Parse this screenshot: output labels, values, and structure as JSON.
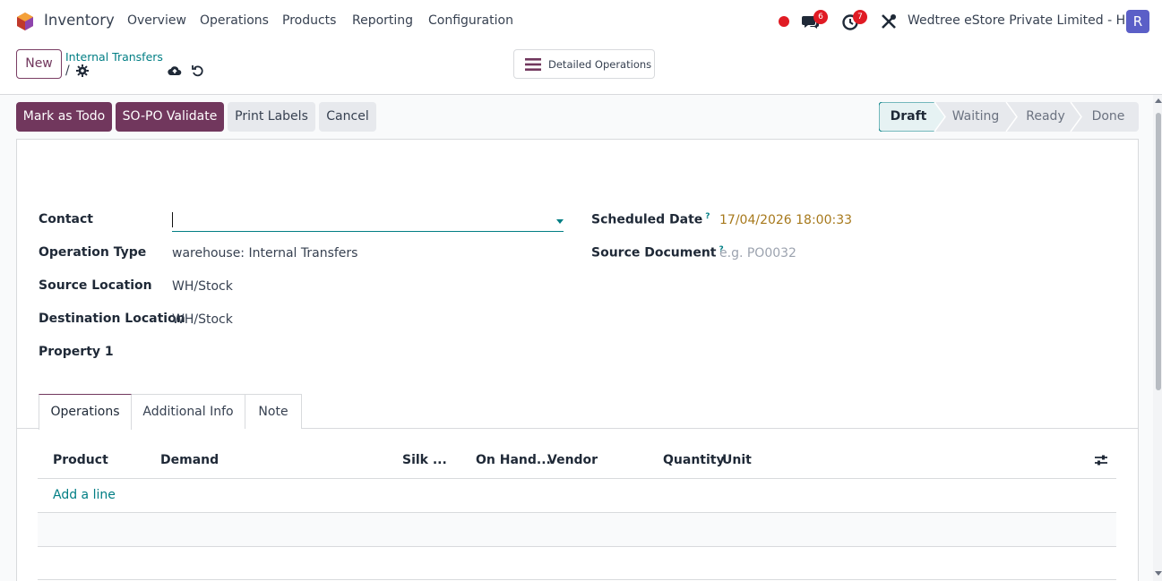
{
  "navbar": {
    "app_name": "Inventory",
    "menu": [
      "Overview",
      "Operations",
      "Products",
      "Reporting",
      "Configuration"
    ],
    "messages_count": "6",
    "activities_count": "7",
    "company": "Wedtree eStore Private Limited - HO",
    "avatar_letter": "R",
    "icons": [
      "inventory-logo-icon",
      "status-dot-icon",
      "chat-icon",
      "clock-icon",
      "tools-icon"
    ]
  },
  "control_panel": {
    "new_label": "New",
    "breadcrumb": "Internal Transfers",
    "breadcrumb_sep": "/",
    "detailed_operations_label": "Detailed Operations"
  },
  "actions": {
    "mark_todo": "Mark as Todo",
    "so_po_validate": "SO-PO Validate",
    "print_labels": "Print Labels",
    "cancel": "Cancel"
  },
  "status_stages": [
    {
      "label": "Draft",
      "active": true
    },
    {
      "label": "Waiting",
      "active": false
    },
    {
      "label": "Ready",
      "active": false
    },
    {
      "label": "Done",
      "active": false
    }
  ],
  "form": {
    "contact_label": "Contact",
    "contact_value": "",
    "operation_type_label": "Operation Type",
    "operation_type_value": "warehouse: Internal Transfers",
    "source_location_label": "Source Location",
    "source_location_value": "WH/Stock",
    "destination_location_label": "Destination Location",
    "destination_location_value": "WH/Stock",
    "property_label": "Property 1",
    "scheduled_date_label": "Scheduled Date",
    "scheduled_date_value": "17/04/2026 18:00:33",
    "source_document_label": "Source Document",
    "source_document_placeholder": "e.g. PO0032",
    "help_mark": "?"
  },
  "tabs": [
    {
      "label": "Operations",
      "active": true
    },
    {
      "label": "Additional Info",
      "active": false
    },
    {
      "label": "Note",
      "active": false
    }
  ],
  "table": {
    "columns": [
      "Product",
      "Demand",
      "Silk ...",
      "On Hand...",
      "Vendor",
      "Quantity",
      "Unit"
    ],
    "add_line": "Add a line"
  },
  "colors": {
    "brand": "#71375d",
    "teal": "#017e84",
    "badge": "#e01b24",
    "scheduled_date": "#a7791c"
  }
}
